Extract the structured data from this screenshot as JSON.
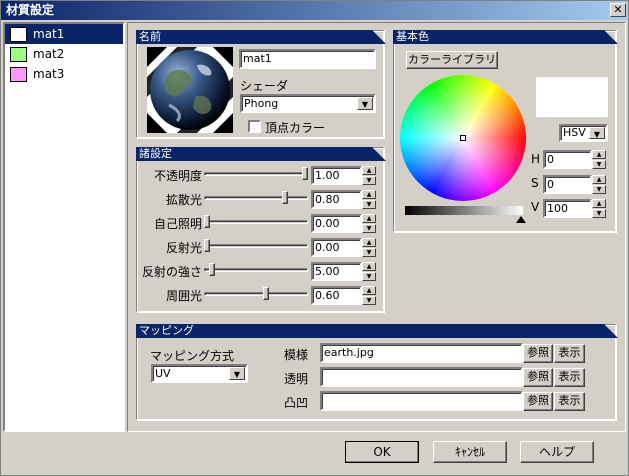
{
  "window": {
    "title": "材質設定",
    "close_label": "✕"
  },
  "materials": [
    {
      "label": "mat1",
      "color": "#ffffff",
      "selected": true
    },
    {
      "label": "mat2",
      "color": "#99ff80",
      "selected": false
    },
    {
      "label": "mat3",
      "color": "#ff99ff",
      "selected": false
    }
  ],
  "name_group": {
    "header": "名前",
    "name_value": "mat1",
    "shader_label": "シェーダ",
    "shader_value": "Phong",
    "vertex_color_label": "頂点カラー",
    "vertex_color_checked": false
  },
  "settings_group": {
    "header": "諸設定",
    "rows": [
      {
        "label": "不透明度",
        "value": "1.00",
        "level": 1.0
      },
      {
        "label": "拡散光",
        "value": "0.80",
        "level": 0.8
      },
      {
        "label": "自己照明",
        "value": "0.00",
        "level": 0.0
      },
      {
        "label": "反射光",
        "value": "0.00",
        "level": 0.0
      },
      {
        "label": "反射の強さ",
        "value": "5.00",
        "level": 0.05
      },
      {
        "label": "周囲光",
        "value": "0.60",
        "level": 0.6
      }
    ]
  },
  "base_color_group": {
    "header": "基本色",
    "library_button": "カラーライブラリ",
    "mode_value": "HSV",
    "h_label": "H",
    "h_value": "0",
    "s_label": "S",
    "s_value": "0",
    "v_label": "V",
    "v_value": "100",
    "preview_color": "#ffffff",
    "brightness_level": 1.0
  },
  "mapping_group": {
    "header": "マッピング",
    "method_label": "マッピング方式",
    "method_value": "UV",
    "rows": [
      {
        "label": "模様",
        "value": "earth.jpg",
        "browse": "参照",
        "show": "表示"
      },
      {
        "label": "透明",
        "value": "",
        "browse": "参照",
        "show": "表示"
      },
      {
        "label": "凸凹",
        "value": "",
        "browse": "参照",
        "show": "表示"
      }
    ]
  },
  "buttons": {
    "ok": "OK",
    "cancel": "ｷｬﾝｾﾙ",
    "help": "ヘルプ"
  },
  "colors": {
    "titlebar": "#0a246a",
    "face": "#d4d0c8",
    "selection": "#0a246a"
  }
}
